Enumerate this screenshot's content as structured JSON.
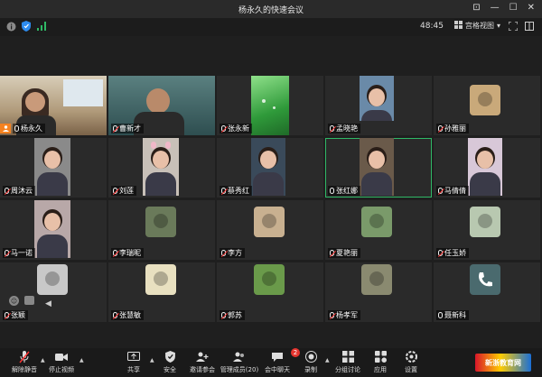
{
  "window": {
    "title": "杨永久的快速会议"
  },
  "header": {
    "timer": "48:45",
    "view_label": "宫格视图"
  },
  "participants": [
    {
      "name": "杨永久",
      "muted": false,
      "host": true
    },
    {
      "name": "曹新才",
      "muted": true
    },
    {
      "name": "张永新",
      "muted": true
    },
    {
      "name": "孟晓艳",
      "muted": true
    },
    {
      "name": "孙雅丽",
      "muted": true
    },
    {
      "name": "周沐云",
      "muted": true
    },
    {
      "name": "刘莲",
      "muted": true
    },
    {
      "name": "蔡秀红",
      "muted": true
    },
    {
      "name": "张红娜",
      "muted": false
    },
    {
      "name": "马倩倩",
      "muted": true
    },
    {
      "name": "马一诺",
      "muted": true
    },
    {
      "name": "李瑞昵",
      "muted": true
    },
    {
      "name": "李方",
      "muted": true
    },
    {
      "name": "夏艳丽",
      "muted": true
    },
    {
      "name": "任玉娇",
      "muted": true
    },
    {
      "name": "张颖",
      "muted": true
    },
    {
      "name": "张慧敏",
      "muted": true
    },
    {
      "name": "郭苏",
      "muted": true
    },
    {
      "name": "杨孝军",
      "muted": true
    },
    {
      "name": "聂新科",
      "muted": false
    }
  ],
  "toolbar": {
    "unmute": "解除静音",
    "stop_video": "停止视频",
    "share": "共享",
    "security": "安全",
    "invite": "邀请参会",
    "manage": "管理成员(20)",
    "chat": "会中聊天",
    "chat_badge": "2",
    "record": "录制",
    "breakout": "分组讨论",
    "apps": "应用",
    "settings": "设置"
  },
  "watermark": {
    "text": "新浙教育网"
  },
  "colors": {
    "active_border": "#2fb866",
    "unread_badge": "#e5352f",
    "host_badge": "#f58220"
  }
}
